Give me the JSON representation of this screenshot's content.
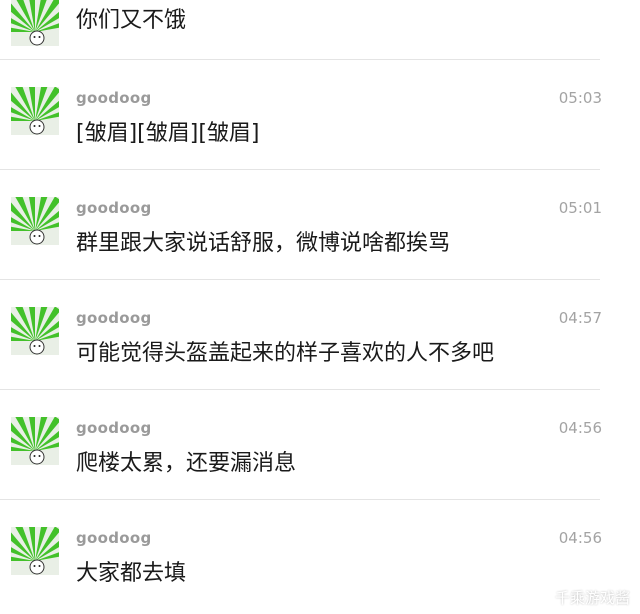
{
  "messages": [
    {
      "name": "",
      "time": "",
      "text": "你们又不饿"
    },
    {
      "name": "goodoog",
      "time": "05:03",
      "text": "[皱眉][皱眉][皱眉]"
    },
    {
      "name": "goodoog",
      "time": "05:01",
      "text": "群里跟大家说话舒服，微博说啥都挨骂"
    },
    {
      "name": "goodoog",
      "time": "04:57",
      "text": "可能觉得头盔盖起来的样子喜欢的人不多吧"
    },
    {
      "name": "goodoog",
      "time": "04:56",
      "text": "爬楼太累，还要漏消息"
    },
    {
      "name": "goodoog",
      "time": "04:56",
      "text": "大家都去填"
    }
  ],
  "watermark": "千乘游戏酱",
  "colors": {
    "avatar_green": "#43c12a",
    "avatar_bg": "#e9efe6",
    "name": "#9a9a9a",
    "time": "#a3a3a3",
    "text": "#1a1a1a"
  }
}
